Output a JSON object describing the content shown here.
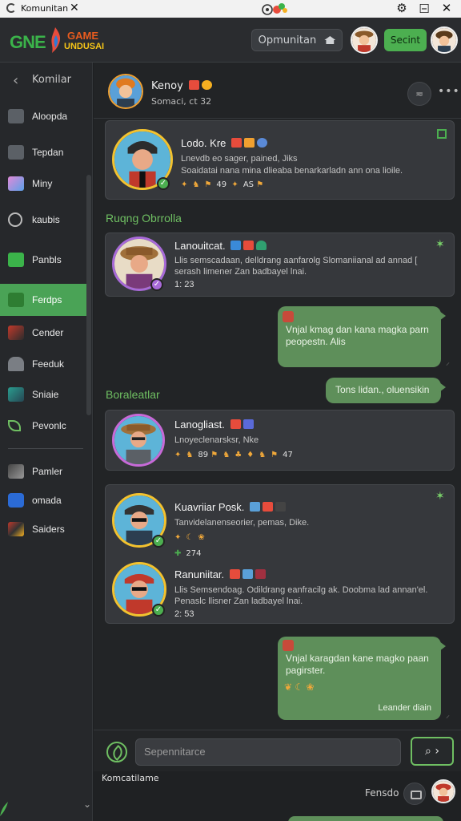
{
  "titlebar": {
    "title": "Komunitan",
    "close_glyph": "✕",
    "controls": [
      "gear-icon",
      "minimize-icon",
      "maximize-icon",
      "close-icon"
    ]
  },
  "header": {
    "logo": {
      "word1": "GNE",
      "word2": "GAME",
      "word3": "UNDUSAI"
    },
    "komunitas_button": "Opmunitan",
    "secint_button": "Secint"
  },
  "sidebar": {
    "back_label": "Komilar",
    "items": [
      {
        "label": "Aloopda",
        "icon": "book-icon"
      },
      {
        "label": "Tepdan",
        "icon": "book-icon"
      },
      {
        "label": "Miny",
        "icon": "game-thumb-icon"
      },
      {
        "label": "kaubis",
        "icon": "controller-icon"
      },
      {
        "label": "Panbls",
        "icon": "check-icon"
      },
      {
        "label": "Ferdps",
        "icon": "book-icon",
        "active": true
      },
      {
        "label": "Cender",
        "icon": "game-thumb-icon"
      },
      {
        "label": "Feeduk",
        "icon": "users-icon"
      },
      {
        "label": "Sniaie",
        "icon": "game-thumb-icon"
      },
      {
        "label": "Pevonlc",
        "icon": "leaf-icon"
      }
    ],
    "items2": [
      {
        "label": "Pamler",
        "icon": "game-thumb-icon"
      },
      {
        "label": "omada",
        "icon": "game-thumb-icon"
      },
      {
        "label": "Saiders",
        "icon": "game-thumb-icon"
      }
    ]
  },
  "chat_header": {
    "name": "Kenoy",
    "sub": "Somaci, ct 32",
    "emojis": [
      "#e74c3c",
      "#f5b021"
    ],
    "action_glyph": "≂",
    "more_glyph": "•••"
  },
  "cards": [
    {
      "name": "Lodo. Kre",
      "line1": "Lnevdb eo sager, pained, Jiks",
      "line2": "Soaidatai nana mina dlieaba benarkarladn ann ona lioile.",
      "stats": [
        "49",
        "AS"
      ],
      "emojis": [
        "#e74c3c",
        "#f0a030",
        "#5a8ad8"
      ]
    },
    {
      "name": "Lanouitcat.",
      "line1": "Llis semscadaan, delldrang aanfarolg Slomaniianal ad annad [",
      "line2": "serash limener Zan badbayel lnai.",
      "time": "1: 23",
      "emojis": [
        "#3a8ad8",
        "#e74c3c",
        "#30a070"
      ]
    },
    {
      "name": "Lanogliast.",
      "line1": "Lnoyeclenarsksr, Nke",
      "stats": [
        "89",
        "47"
      ],
      "emojis": [
        "#e74c3c",
        "#5a6ad8"
      ]
    },
    {
      "name": "Kuavriiar Posk.",
      "line1": "Tanvidelanenseorier, pemas, Dike.",
      "stat": "274",
      "emojis": [
        "#5aa0d8",
        "#e74c3c",
        "#444"
      ]
    },
    {
      "name": "Ranuniitar.",
      "line1": "Llis Semsendoag. Odildrang eanfracilg ak. Doobma lad annan'el.",
      "line2": "Penaslc llisner Zan ladbayel lnai.",
      "time": "2: 53",
      "emojis": [
        "#e74c3c",
        "#5aa0d8",
        "#a03040"
      ]
    }
  ],
  "sections": [
    "Ruqng Obrrolla",
    "Boraleatlar"
  ],
  "bubbles": [
    {
      "text": "Vnjal kmag dan kana magka parn peopestn. Alis"
    },
    {
      "text": "Tons lidan., oluensikin"
    },
    {
      "text": "Vnjal karagdan kane magko paan pagirster.",
      "footer": "Leander diain"
    }
  ],
  "composer": {
    "placeholder": "Sepennitarce",
    "send_glyph": "⌕ ›"
  },
  "footer": {
    "label": "Komcatilame",
    "right": "Fensdo"
  }
}
